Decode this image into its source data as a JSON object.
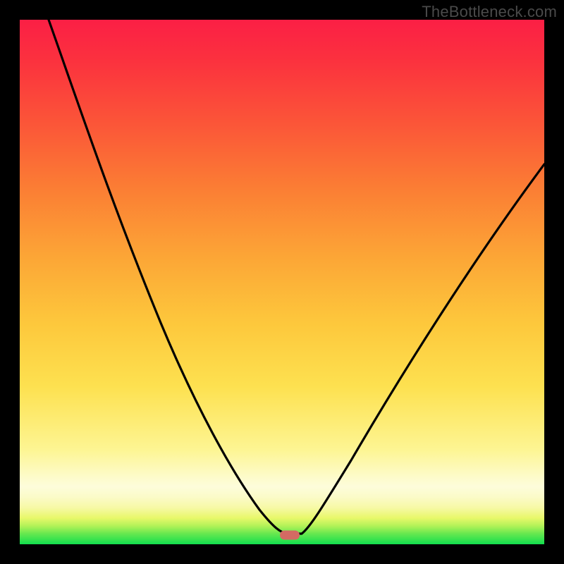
{
  "watermark": "TheBottleneck.com",
  "marker": {
    "x_frac": 0.515,
    "y_frac": 0.983
  },
  "chart_data": {
    "type": "line",
    "title": "",
    "xlabel": "",
    "ylabel": "",
    "xlim": [
      0,
      1
    ],
    "ylim": [
      0,
      1
    ],
    "series": [
      {
        "name": "curve",
        "x": [
          0.055,
          0.1,
          0.15,
          0.2,
          0.25,
          0.3,
          0.35,
          0.4,
          0.44,
          0.465,
          0.49,
          0.51,
          0.54,
          0.57,
          0.62,
          0.68,
          0.74,
          0.8,
          0.86,
          0.92,
          1.0
        ],
        "y": [
          1.0,
          0.885,
          0.77,
          0.66,
          0.555,
          0.455,
          0.36,
          0.26,
          0.165,
          0.095,
          0.035,
          0.025,
          0.035,
          0.065,
          0.14,
          0.235,
          0.33,
          0.425,
          0.52,
          0.61,
          0.72
        ]
      }
    ],
    "gradient_stops": [
      {
        "pos": 0.0,
        "color": "#12de4e"
      },
      {
        "pos": 0.05,
        "color": "#e8f86a"
      },
      {
        "pos": 0.11,
        "color": "#fdfcdb"
      },
      {
        "pos": 0.3,
        "color": "#fde150"
      },
      {
        "pos": 0.55,
        "color": "#fca536"
      },
      {
        "pos": 0.8,
        "color": "#fb5638"
      },
      {
        "pos": 1.0,
        "color": "#fb1f45"
      }
    ]
  }
}
